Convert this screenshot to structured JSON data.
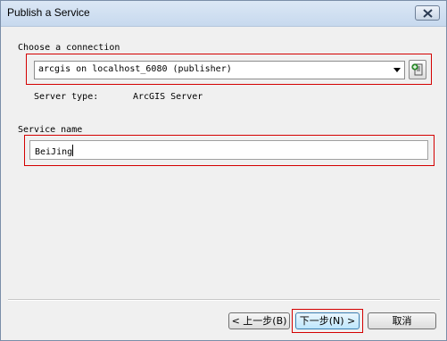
{
  "window": {
    "title": "Publish a Service"
  },
  "connection": {
    "label": "Choose a connection",
    "selected": "arcgis on localhost_6080 (publisher)",
    "server_type_label": "Server type:",
    "server_type_value": "ArcGIS Server"
  },
  "service": {
    "label": "Service name",
    "value": "BeiJing"
  },
  "buttons": {
    "back": "< 上一步(B)",
    "next": "下一步(N) >",
    "cancel": "取消"
  },
  "colors": {
    "highlight": "#d40000",
    "titlebar": "#c7d9ee"
  }
}
